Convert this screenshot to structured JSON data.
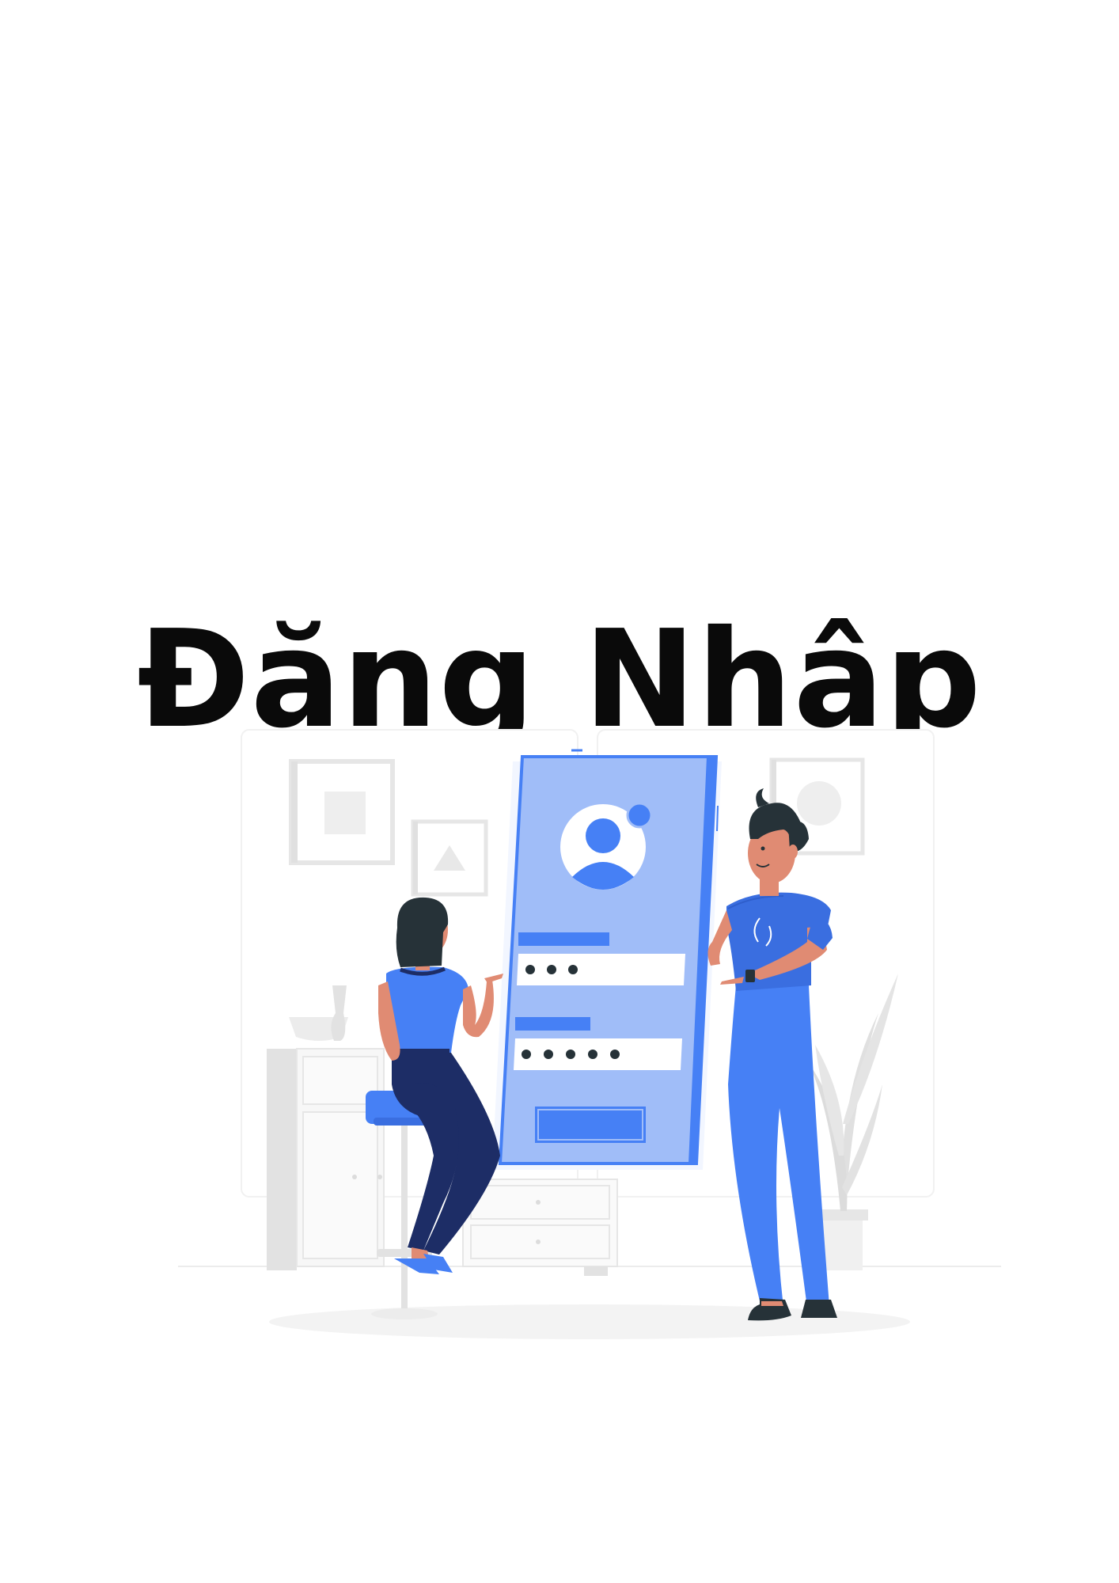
{
  "page": {
    "title": "Đăng Nhập"
  },
  "illustration": {
    "name": "login-illustration",
    "password_dots_1": 3,
    "password_dots_2": 5
  },
  "colors": {
    "primary_blue": "#4680f5",
    "light_blue": "#a0bdf8",
    "navy": "#1d2d66",
    "skin": "#e08b73",
    "hair": "#263238",
    "gray_light": "#f2f2f2",
    "gray_mid": "#e3e3e3"
  }
}
